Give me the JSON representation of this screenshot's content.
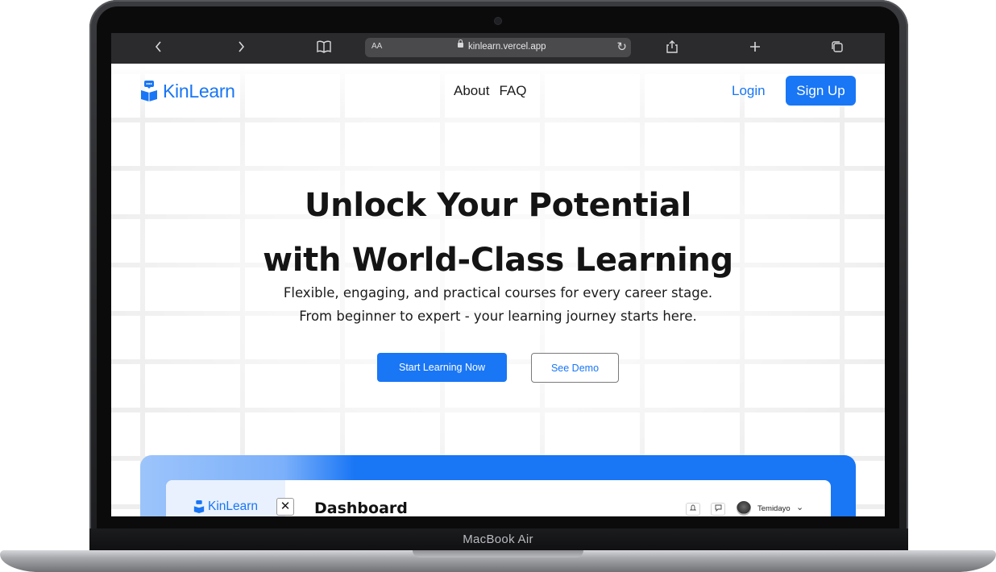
{
  "device": {
    "label": "MacBook Air"
  },
  "browser": {
    "text_size_label": "AA",
    "url": "kinlearn.vercel.app"
  },
  "nav": {
    "brand": "KinLearn",
    "links": [
      "About",
      "FAQ"
    ],
    "login_label": "Login",
    "signup_label": "Sign Up"
  },
  "hero": {
    "title_line1": "Unlock Your Potential",
    "title_line2": "with World-Class Learning",
    "subtitle_line1": "Flexible, engaging, and practical courses for every career stage.",
    "subtitle_line2": "From beginner to expert - your learning journey starts here.",
    "primary_cta": "Start Learning Now",
    "secondary_cta": "See Demo"
  },
  "preview": {
    "brand": "KinLearn",
    "title": "Dashboard",
    "user_name": "Temidayo"
  },
  "colors": {
    "accent": "#1976f5",
    "toolbar": "#2b2b2d"
  }
}
